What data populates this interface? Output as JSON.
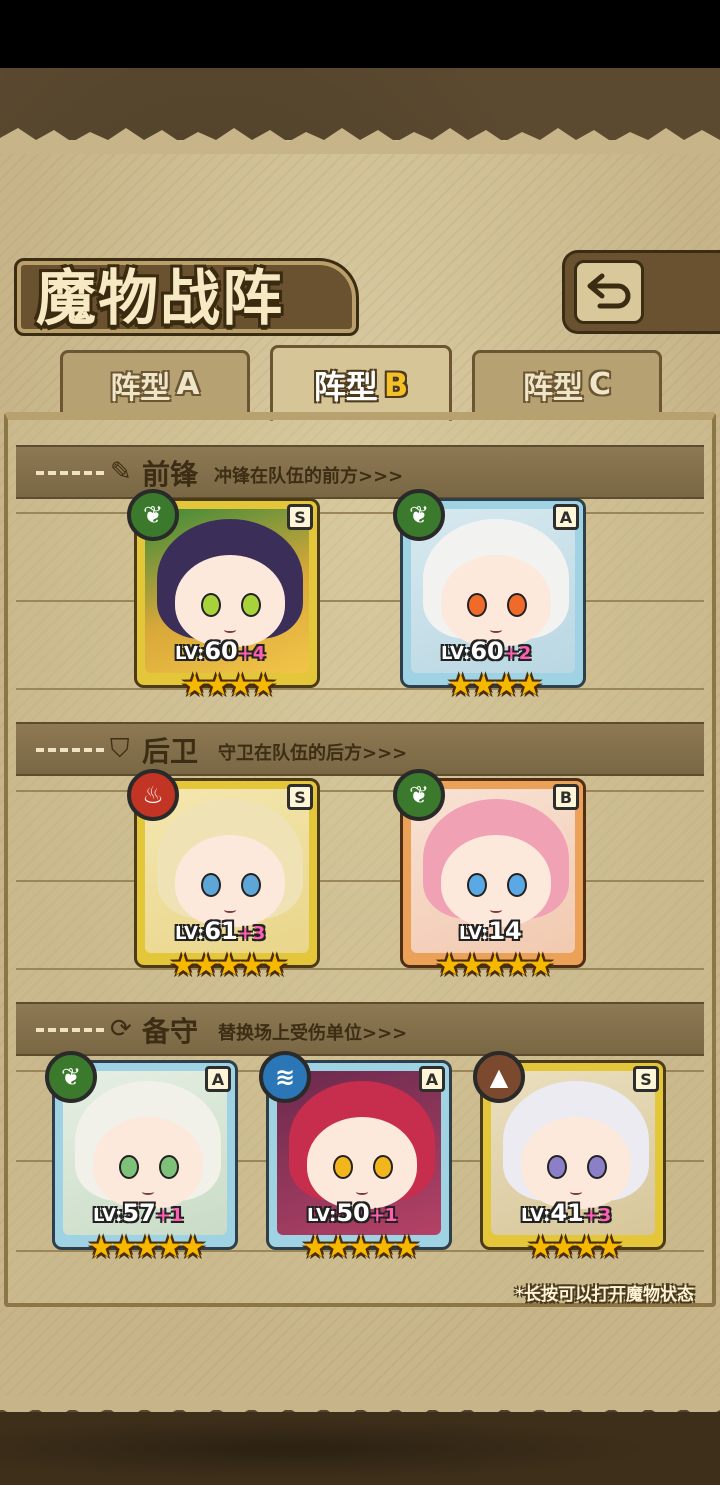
{
  "header": {
    "title": "魔物战阵",
    "back_icon": "back-arrow-icon"
  },
  "tabs": [
    {
      "label": "阵型",
      "letter": "A",
      "active": false
    },
    {
      "label": "阵型",
      "letter": "B",
      "active": true
    },
    {
      "label": "阵型",
      "letter": "C",
      "active": false
    }
  ],
  "sections": {
    "vanguard": {
      "icon": "sword-icon",
      "title": "前锋",
      "subtitle": "冲锋在队伍的前方>>>"
    },
    "rear": {
      "icon": "shield-icon",
      "title": "后卫",
      "subtitle": "守卫在队伍的后方>>>"
    },
    "reserve": {
      "icon": "swap-icon",
      "title": "备守",
      "subtitle": "替换场上受伤单位>>>"
    }
  },
  "cards": {
    "v1": {
      "element": "nature",
      "grade": "S",
      "level": "60",
      "bonus": "+4",
      "stars": 4
    },
    "v2": {
      "element": "nature",
      "grade": "A",
      "level": "60",
      "bonus": "+2",
      "stars": 4
    },
    "r1": {
      "element": "fire",
      "grade": "S",
      "level": "61",
      "bonus": "+3",
      "stars": 5
    },
    "r2": {
      "element": "nature",
      "grade": "B",
      "level": "14",
      "bonus": "",
      "stars": 5
    },
    "s1": {
      "element": "nature",
      "grade": "A",
      "level": "57",
      "bonus": "+1",
      "stars": 5
    },
    "s2": {
      "element": "water",
      "grade": "A",
      "level": "50",
      "bonus": "+1",
      "stars": 5
    },
    "s3": {
      "element": "earth",
      "grade": "S",
      "level": "41",
      "bonus": "+3",
      "stars": 4
    }
  },
  "level_prefix": "LV:",
  "star_glyph": "★",
  "hint": "*长按可以打开魔物状态"
}
